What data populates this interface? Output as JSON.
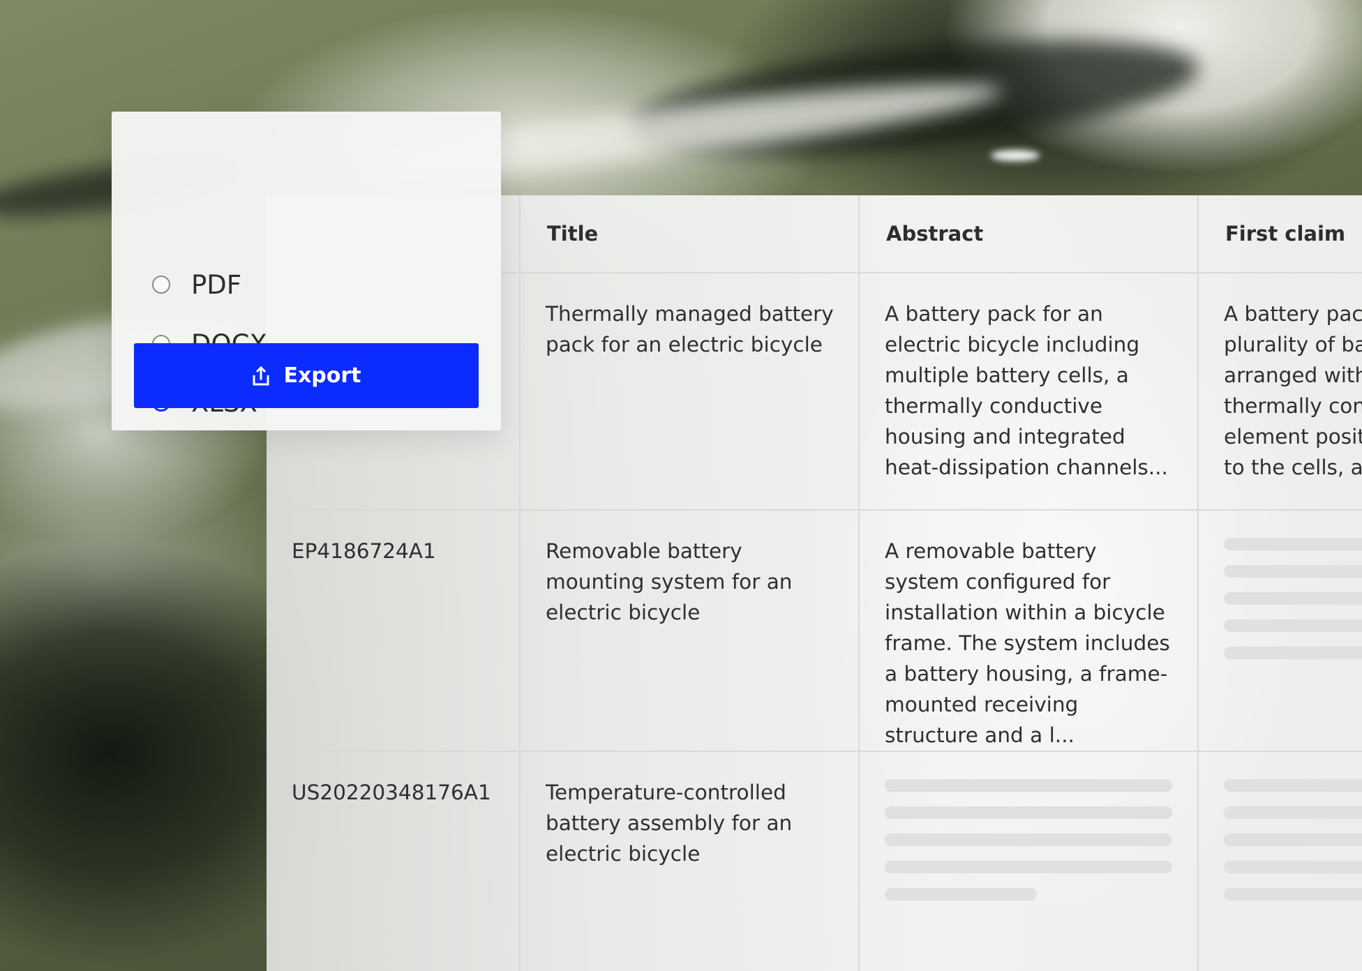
{
  "export_menu": {
    "formats": [
      {
        "label": "PDF",
        "selected": false
      },
      {
        "label": "DOCX",
        "selected": false
      },
      {
        "label": "XLSX",
        "selected": true
      }
    ],
    "export_label": "Export",
    "accent_color": "#0b2bff"
  },
  "results_table": {
    "columns": [
      "",
      "Title",
      "Abstract",
      "First claim"
    ],
    "rows": [
      {
        "id": "",
        "title": "Thermally managed battery pack for an electric bicycle",
        "abstract": "A battery pack for an electric bicycle including multiple battery cells, a thermally conductive housing and integrated heat-dissipation channels...",
        "first_claim": [
          "A battery pack",
          "plurality of ba",
          "arranged with",
          "thermally con",
          "element posit",
          "to the cells, ar"
        ]
      },
      {
        "id": "EP4186724A1",
        "title": "Removable battery mounting system for an electric bicycle",
        "abstract": "A removable battery system configured for installation within a bicycle frame. The system includes a battery housing, a frame-mounted receiving structure and a l...",
        "first_claim": null
      },
      {
        "id": "US20220348176A1",
        "title": "Temperature-controlled battery assembly for an electric bicycle",
        "abstract": null,
        "first_claim": null
      }
    ]
  }
}
